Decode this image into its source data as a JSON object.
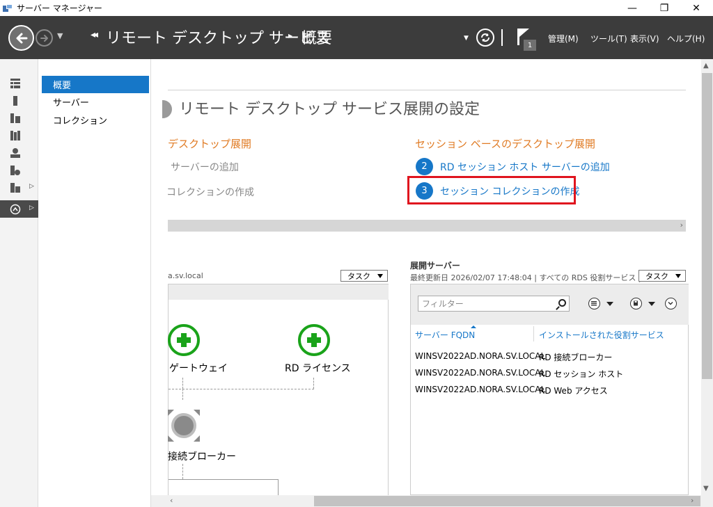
{
  "window": {
    "title": "サーバー マネージャー",
    "controls": {
      "minimize": "—",
      "maximize": "❐",
      "close": "✕"
    }
  },
  "header": {
    "breadcrumb_root": "リモート デスクトップ サービス",
    "breadcrumb_page": "概要",
    "notification_count": "1",
    "menus": {
      "manage": "管理(M)",
      "tools": "ツール(T)",
      "view": "表示(V)",
      "help": "ヘルプ(H)"
    }
  },
  "nav": {
    "items": [
      {
        "label": "概要"
      },
      {
        "label": "サーバー"
      },
      {
        "label": "コレクション"
      }
    ]
  },
  "overview": {
    "section_title": "リモート デスクトップ サービス展開の設定",
    "left_heading": "デスクトップ展開",
    "left_links": {
      "add_servers": "サーバーの追加",
      "create_collection": "コレクションの作成"
    },
    "right_heading": "セッション ベースのデスクトップ展開",
    "steps": [
      {
        "number": "2",
        "label": "RD セッション ホスト サーバーの追加"
      },
      {
        "number": "3",
        "label": "セッション コレクションの作成"
      }
    ]
  },
  "deployment": {
    "domain_label": "a.sv.local",
    "task_label": "タスク",
    "nodes": {
      "gateway": "ゲートウェイ",
      "licensing": "RD ライセンス",
      "broker": "接続ブローカー"
    }
  },
  "deploy_servers": {
    "title": "展開サーバー",
    "subtitle": "最終更新日 2026/02/07 17:48:04 | すべての RDS 役割サービス |...",
    "task_label": "タスク",
    "filter_placeholder": "フィルター",
    "columns": {
      "fqdn": "サーバー FQDN",
      "roles": "インストールされた役割サービス"
    },
    "rows": [
      {
        "fqdn": "WINSV2022AD.NORA.SV.LOCAL",
        "role": "RD 接続ブローカー"
      },
      {
        "fqdn": "WINSV2022AD.NORA.SV.LOCAL",
        "role": "RD セッション ホスト"
      },
      {
        "fqdn": "WINSV2022AD.NORA.SV.LOCAL",
        "role": "RD Web アクセス"
      }
    ]
  },
  "colors": {
    "header_bg": "#3c3c3c",
    "accent_blue": "#1677c8",
    "orange": "#e07b24",
    "highlight_red": "#e0141e",
    "add_green": "#1aa31a"
  }
}
